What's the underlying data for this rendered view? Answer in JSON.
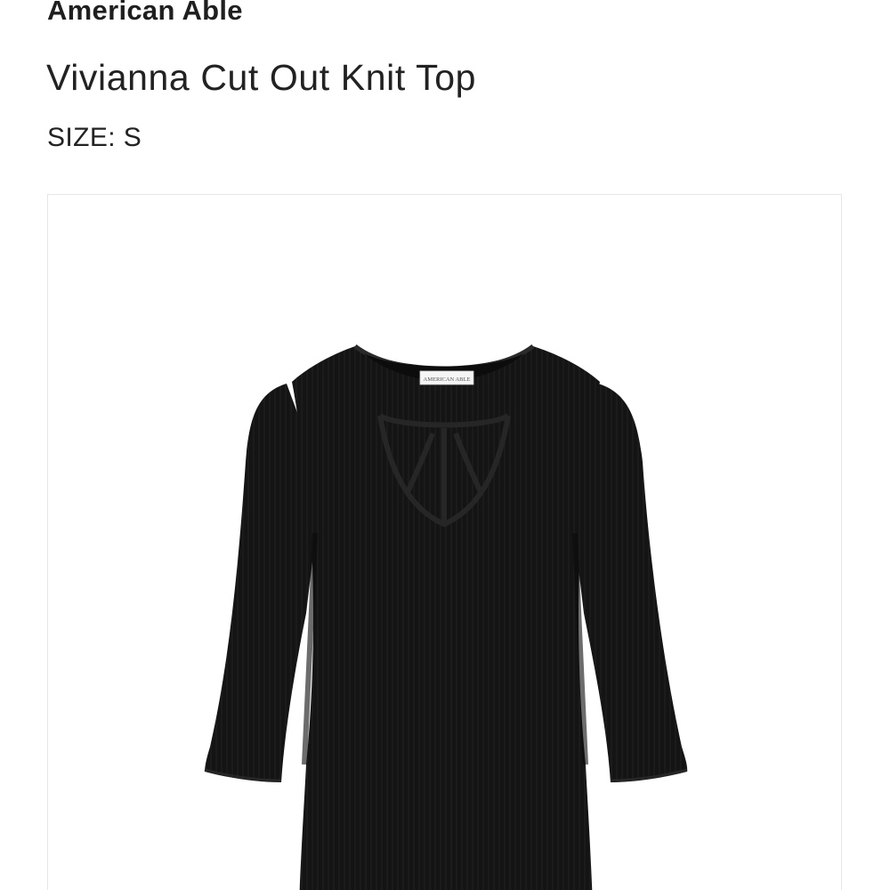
{
  "product": {
    "brand": "American Able",
    "name": "Vivianna Cut Out Knit Top",
    "size_label": "SIZE:",
    "size_value": "S"
  },
  "image": {
    "subject": "top-photo",
    "garment_color": "#111111",
    "tag_text": "AMERICAN ABLE"
  }
}
